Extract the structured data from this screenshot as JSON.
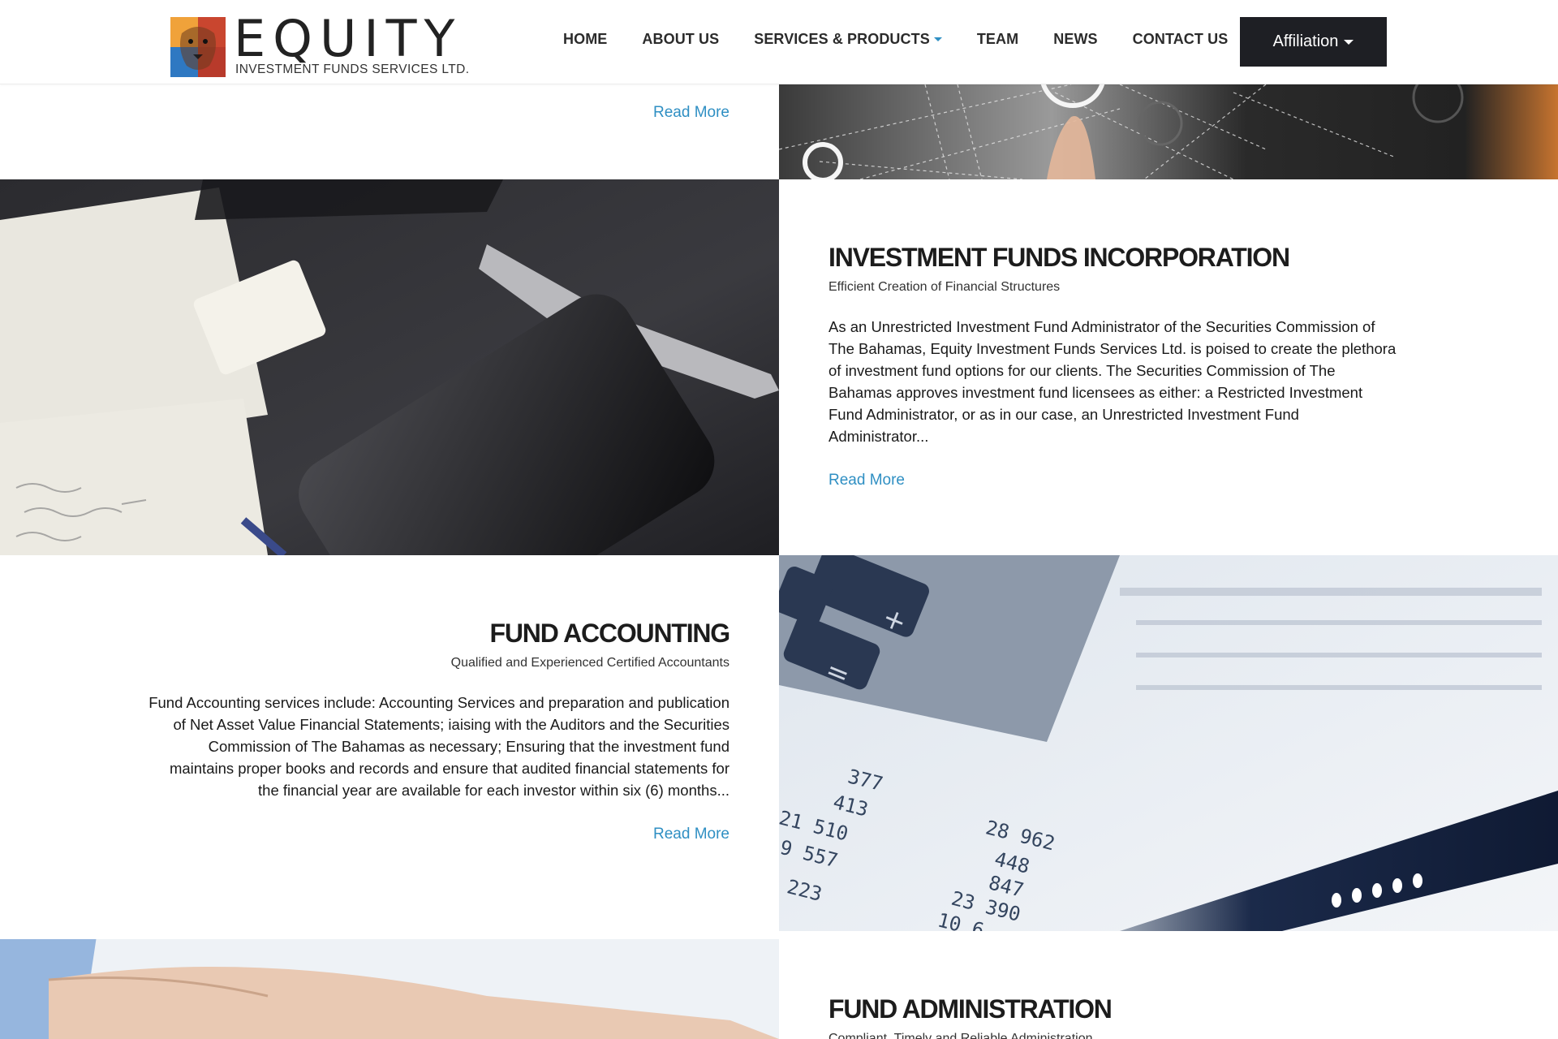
{
  "brand": {
    "name": "EQUITY",
    "subtitle": "INVESTMENT FUNDS SERVICES LTD."
  },
  "nav": {
    "items": [
      "HOME",
      "ABOUT US",
      "SERVICES & PRODUCTS",
      "TEAM",
      "NEWS",
      "CONTACT US"
    ],
    "affiliation": "Affiliation"
  },
  "sections": {
    "top": {
      "read_more": "Read More"
    },
    "incorporation": {
      "title": "INVESTMENT FUNDS INCORPORATION",
      "subtitle": "Efficient Creation of Financial Structures",
      "body": "As an Unrestricted Investment Fund Administrator of the Securities Commission of The Bahamas, Equity Investment Funds Services Ltd. is poised to create the plethora of investment fund options for our clients. The Securities Commission of The Bahamas approves investment fund licensees as either: a Restricted Investment Fund Administrator, or as in our case, an Unrestricted Investment Fund Administrator...",
      "read_more": "Read More"
    },
    "accounting": {
      "title": "FUND ACCOUNTING",
      "subtitle": "Qualified and Experienced Certified Accountants",
      "body": "Fund Accounting services include: Accounting Services and preparation and publication of Net Asset Value Financial Statements; iaising with the Auditors and the Securities Commission of The Bahamas as necessary; Ensuring that the investment fund maintains proper books and records and ensure that audited financial statements for the financial year are available for each investor within six (6) months...",
      "read_more": "Read More"
    },
    "administration": {
      "title": "FUND ADMINISTRATION",
      "subtitle": "Compliant, Timely and Reliable Administration"
    }
  },
  "calc_sheet_numbers": [
    "377",
    "413",
    "21 510",
    "9 557",
    "223",
    "28 962",
    "448",
    "847",
    "23 390",
    "10 6"
  ],
  "colors": {
    "accent": "#2f8fc3",
    "dark_button": "#1e1f24",
    "heading": "#1c1c1c"
  },
  "icons": [
    "lion-logo-icon",
    "chevron-down-icon"
  ]
}
